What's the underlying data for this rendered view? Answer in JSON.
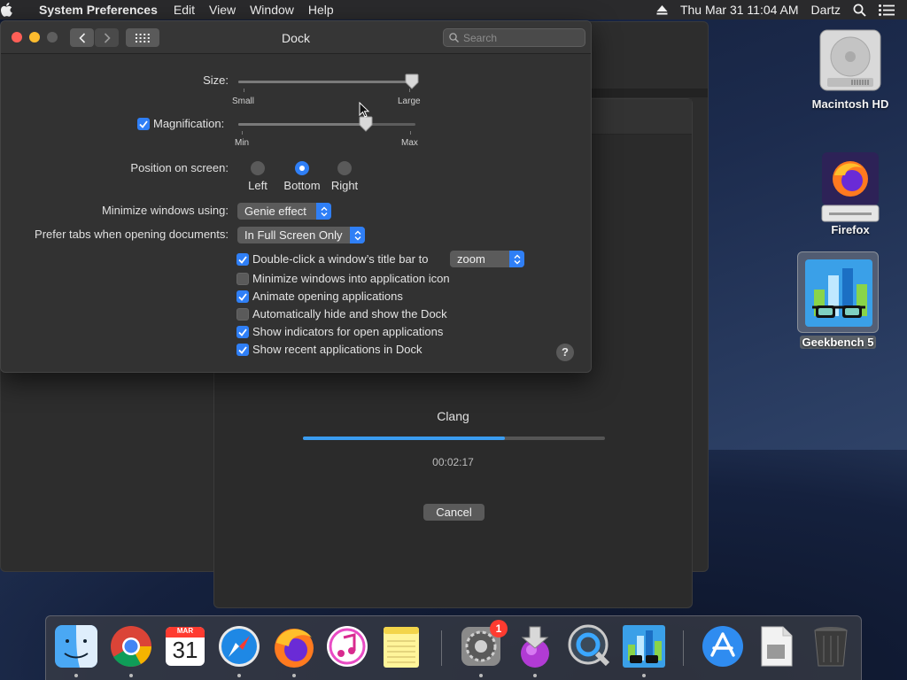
{
  "menubar": {
    "app_name": "System Preferences",
    "items": [
      "Edit",
      "View",
      "Window",
      "Help"
    ],
    "clock": "Thu Mar 31  11:04 AM",
    "user": "Dartz"
  },
  "window": {
    "title": "Dock",
    "search_placeholder": "Search"
  },
  "size": {
    "label": "Size:",
    "min_label": "Small",
    "max_label": "Large",
    "value": 0.98
  },
  "magnification": {
    "label": "Magnification:",
    "checked": true,
    "min_label": "Min",
    "max_label": "Max",
    "value": 0.72
  },
  "position": {
    "label": "Position on screen:",
    "options": [
      "Left",
      "Bottom",
      "Right"
    ],
    "selected": "Bottom"
  },
  "minimize_using": {
    "label": "Minimize windows using:",
    "value": "Genie effect"
  },
  "prefer_tabs": {
    "label": "Prefer tabs when opening documents:",
    "value": "In Full Screen Only"
  },
  "checkboxes": {
    "double_click": {
      "label": "Double-click a window’s title bar to",
      "checked": true,
      "popup_value": "zoom"
    },
    "minimize_into_icon": {
      "label": "Minimize windows into application icon",
      "checked": false
    },
    "animate": {
      "label": "Animate opening applications",
      "checked": true
    },
    "autohide": {
      "label": "Automatically hide and show the Dock",
      "checked": false
    },
    "indicators": {
      "label": "Show indicators for open applications",
      "checked": true
    },
    "recent_apps": {
      "label": "Show recent applications in Dock",
      "checked": true
    }
  },
  "help": {
    "label": "?"
  },
  "progress_window": {
    "title": "Clang",
    "progress": 0.67,
    "elapsed": "00:02:17",
    "cancel_label": "Cancel"
  },
  "desktop": {
    "icons": [
      {
        "label": "Macintosh HD"
      },
      {
        "label": "Firefox"
      },
      {
        "label": "Geekbench 5"
      }
    ]
  },
  "dock": {
    "badge_count": "1",
    "calendar_month": "MAR",
    "calendar_day": "31"
  },
  "colors": {
    "accent": "#2f7ff6",
    "progress": "#3a9cf0",
    "badge": "#ff3b30"
  }
}
